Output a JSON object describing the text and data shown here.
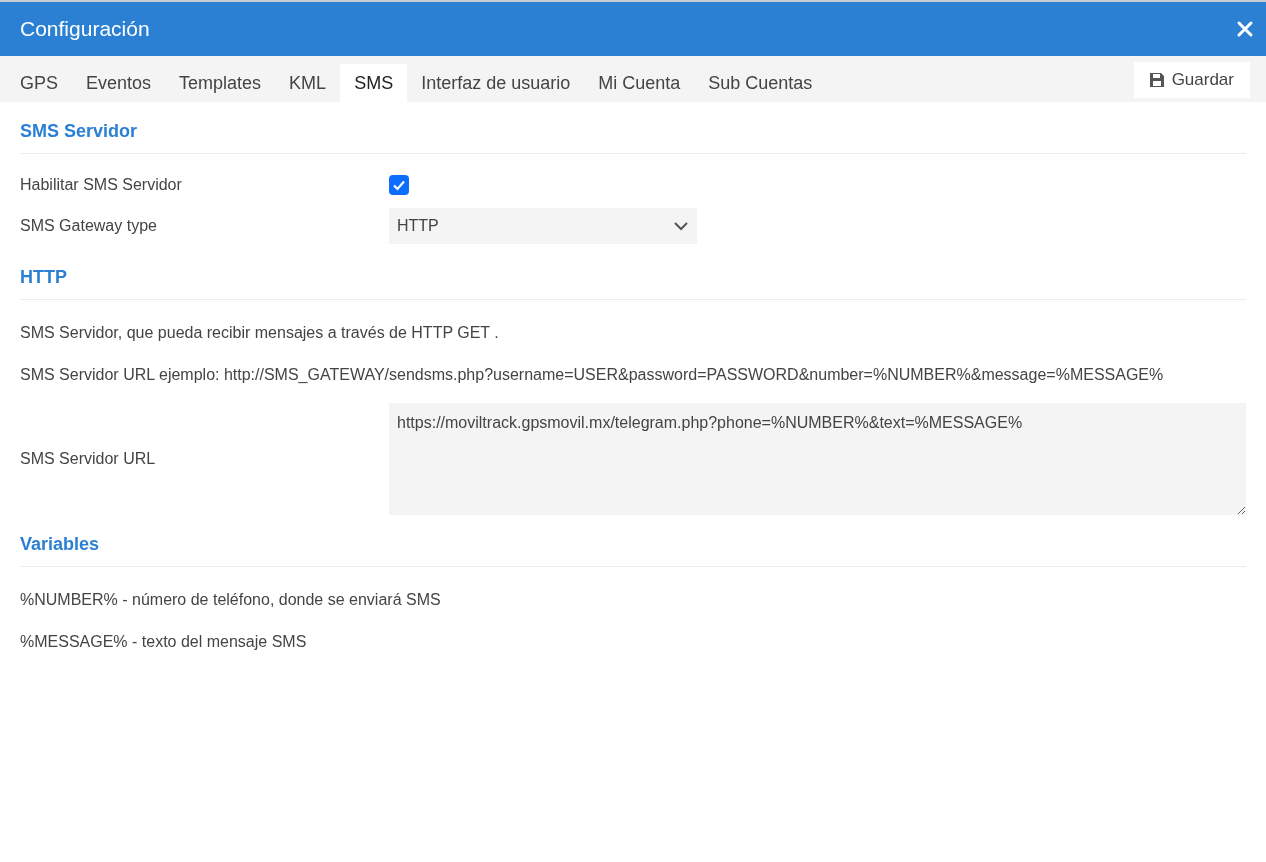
{
  "window": {
    "title": "Configuración"
  },
  "tabs": [
    {
      "label": "GPS",
      "selected": false
    },
    {
      "label": "Eventos",
      "selected": false
    },
    {
      "label": "Templates",
      "selected": false
    },
    {
      "label": "KML",
      "selected": false
    },
    {
      "label": "SMS",
      "selected": true
    },
    {
      "label": "Interfaz de usuario",
      "selected": false
    },
    {
      "label": "Mi Cuenta",
      "selected": false
    },
    {
      "label": "Sub Cuentas",
      "selected": false
    }
  ],
  "save_button": {
    "label": "Guardar"
  },
  "sections": [
    {
      "title": "SMS Servidor",
      "items": [
        {
          "kind": "checkbox",
          "label": "Habilitar SMS Servidor",
          "checked": true
        },
        {
          "kind": "select",
          "label": "SMS Gateway type",
          "value": "HTTP"
        }
      ]
    },
    {
      "title": "HTTP",
      "items": [
        {
          "kind": "text",
          "text": "SMS Servidor, que pueda recibir mensajes a través de HTTP GET ."
        },
        {
          "kind": "text",
          "text": "SMS Servidor URL ejemplo: http://SMS_GATEWAY/sendsms.php?username=USER&password=PASSWORD&number=%NUMBER%&message=%MESSAGE%"
        },
        {
          "kind": "textarea",
          "label": "SMS Servidor URL",
          "value": "https://moviltrack.gpsmovil.mx/telegram.php?phone=%NUMBER%&text=%MESSAGE%"
        }
      ]
    },
    {
      "title": "Variables",
      "items": [
        {
          "kind": "text",
          "text": "%NUMBER% - número de teléfono, donde se enviará SMS"
        },
        {
          "kind": "text",
          "text": "%MESSAGE% - texto del mensaje SMS"
        }
      ]
    }
  ]
}
